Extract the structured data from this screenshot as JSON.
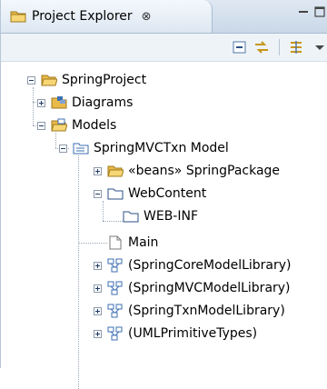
{
  "view": {
    "tab_title": "Project Explorer",
    "close_glyph": "⊗"
  },
  "icons": {
    "project": "open-folder-icon",
    "diagrams": "diagrams-folder-icon",
    "models": "models-folder-icon",
    "model": "uml-model-icon",
    "package": "package-icon",
    "folder": "folder-icon",
    "file": "file-icon",
    "library": "model-library-icon"
  },
  "tree": {
    "project": "SpringProject",
    "diagrams": "Diagrams",
    "models": "Models",
    "model": "SpringMVCTxn Model",
    "beans_package": "«beans» SpringPackage",
    "webcontent": "WebContent",
    "webinf": "WEB-INF",
    "main": "Main",
    "lib_core": "(SpringCoreModelLibrary)",
    "lib_mvc": "(SpringMVCModelLibrary)",
    "lib_txn": "(SpringTxnModelLibrary)",
    "lib_uml": "(UMLPrimitiveTypes)"
  },
  "colors": {
    "tab_bg": "#dde7f2",
    "toolbar_bg": "#eef3f8",
    "folder": "#e9b94a",
    "model_blue": "#3d6fb3"
  }
}
